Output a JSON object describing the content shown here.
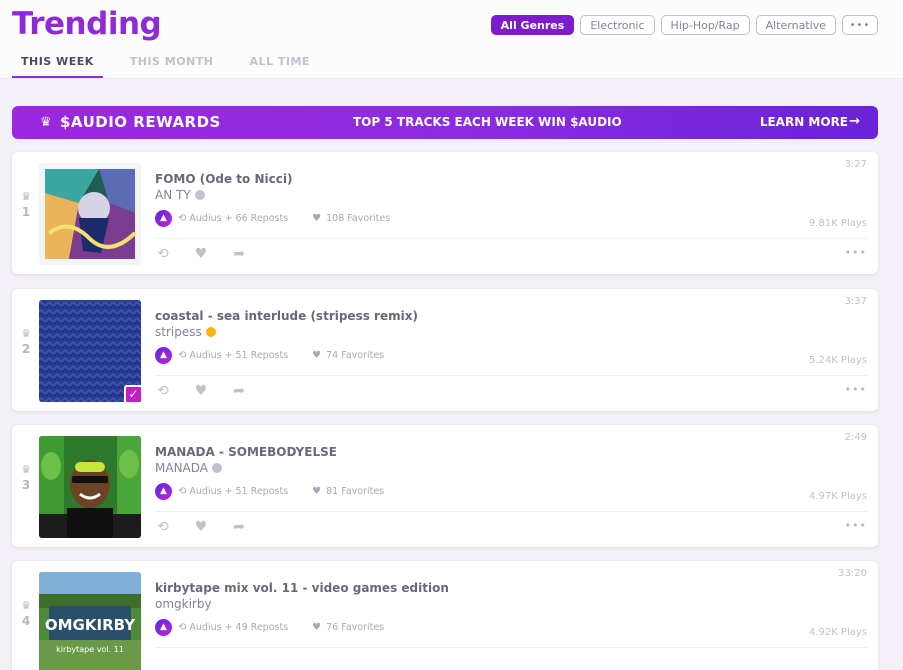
{
  "page": {
    "title": "Trending"
  },
  "tabs": [
    {
      "label": "THIS WEEK",
      "active": true
    },
    {
      "label": "THIS MONTH",
      "active": false
    },
    {
      "label": "ALL TIME",
      "active": false
    }
  ],
  "genres": [
    {
      "label": "All Genres",
      "active": true
    },
    {
      "label": "Electronic",
      "active": false
    },
    {
      "label": "Hip-Hop/Rap",
      "active": false
    },
    {
      "label": "Alternative",
      "active": false
    },
    {
      "label": "•••",
      "active": false
    }
  ],
  "banner": {
    "title": "$AUDIO REWARDS",
    "message": "TOP 5 TRACKS EACH WEEK WIN $AUDIO",
    "link": "LEARN MORE",
    "crown_icon": "♛",
    "arrow_icon": "→"
  },
  "colors": {
    "accent": "#8f2bd6",
    "active_pill": "#7e1bcc",
    "badge_gold": "#f2b416",
    "check": "#c11ec4"
  },
  "tracks": [
    {
      "rank": "1",
      "title": "FOMO (Ode to Nicci)",
      "artist": "AN TY",
      "reposts": "Audius + 66 Reposts",
      "favorites": "108 Favorites",
      "duration": "3:27",
      "plays": "9.81K Plays",
      "verified_badge": "grey"
    },
    {
      "rank": "2",
      "title": "coastal - sea interlude (stripess remix)",
      "artist": "stripess",
      "reposts": "Audius + 51 Reposts",
      "favorites": "74 Favorites",
      "duration": "3:37",
      "plays": "5.24K Plays",
      "verified_badge": "gold"
    },
    {
      "rank": "3",
      "title": "MANADA - SOMEBODYELSE",
      "artist": "MANADA",
      "reposts": "Audius + 51 Reposts",
      "favorites": "81 Favorites",
      "duration": "2:49",
      "plays": "4.97K Plays",
      "verified_badge": "grey"
    },
    {
      "rank": "4",
      "title": "kirbytape mix vol. 11 - video games edition",
      "artist": "omgkirby",
      "reposts": "Audius + 49 Reposts",
      "favorites": "76 Favorites",
      "duration": "33:20",
      "plays": "4.92K Plays",
      "verified_badge": "none",
      "artwork_text": "OMGKIRBY",
      "artwork_subtext": "kirbytape vol. 11"
    }
  ],
  "icons": {
    "rank": "♛",
    "repost": "⟲",
    "heart": "♥",
    "share": "➦",
    "overflow": "•••",
    "check": "✓",
    "logo": "▲"
  }
}
